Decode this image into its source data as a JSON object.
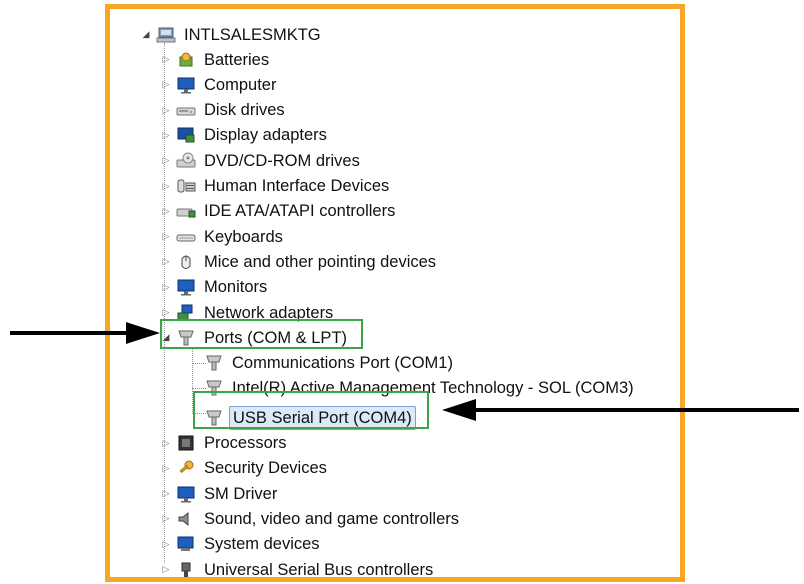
{
  "root": {
    "label": "INTLSALESMKTG",
    "icon": "computer-root-icon",
    "expanded": true
  },
  "categories": [
    {
      "label": "Batteries",
      "icon": "battery-icon"
    },
    {
      "label": "Computer",
      "icon": "monitor-icon"
    },
    {
      "label": "Disk drives",
      "icon": "disk-drive-icon"
    },
    {
      "label": "Display adapters",
      "icon": "display-adapter-icon"
    },
    {
      "label": "DVD/CD-ROM drives",
      "icon": "dvd-drive-icon"
    },
    {
      "label": "Human Interface Devices",
      "icon": "hid-icon"
    },
    {
      "label": "IDE ATA/ATAPI controllers",
      "icon": "ide-controller-icon"
    },
    {
      "label": "Keyboards",
      "icon": "keyboard-icon"
    },
    {
      "label": "Mice and other pointing devices",
      "icon": "mouse-icon"
    },
    {
      "label": "Monitors",
      "icon": "monitor-icon"
    },
    {
      "label": "Network adapters",
      "icon": "network-adapter-icon"
    },
    {
      "label": "Ports (COM & LPT)",
      "icon": "port-icon",
      "expanded": true,
      "children": [
        {
          "label": "Communications Port (COM1)",
          "icon": "port-icon"
        },
        {
          "label": "Intel(R) Active Management Technology - SOL (COM3)",
          "icon": "port-icon"
        },
        {
          "label": "USB Serial Port (COM4)",
          "icon": "port-icon",
          "selected": true
        }
      ]
    },
    {
      "label": "Processors",
      "icon": "processor-icon"
    },
    {
      "label": "Security Devices",
      "icon": "security-key-icon"
    },
    {
      "label": "SM Driver",
      "icon": "monitor-icon"
    },
    {
      "label": "Sound, video and game controllers",
      "icon": "speaker-icon"
    },
    {
      "label": "System devices",
      "icon": "system-devices-icon"
    },
    {
      "label": "Universal Serial Bus controllers",
      "icon": "usb-icon"
    }
  ],
  "colors": {
    "frame": "#f5a623",
    "highlight_box": "#3aa649",
    "selection": "#dbe9f8",
    "arrow": "#000000"
  }
}
